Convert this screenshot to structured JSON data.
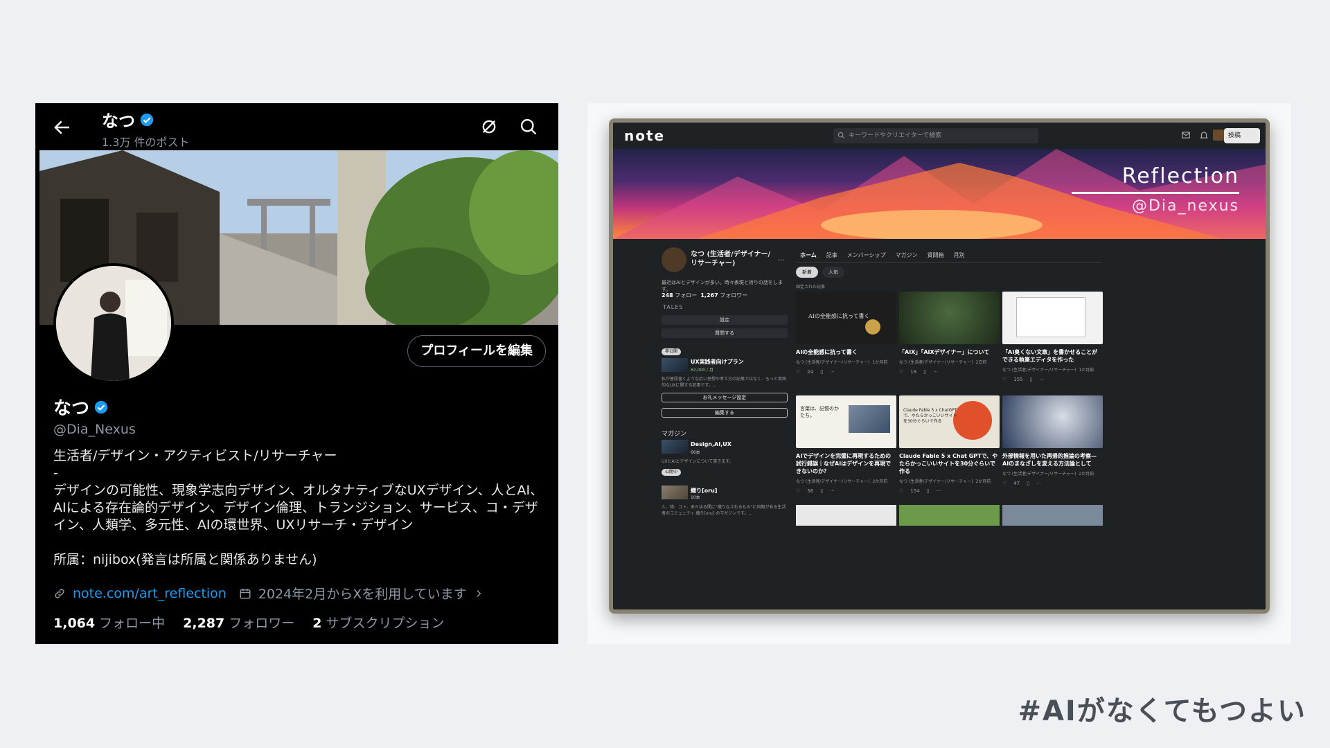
{
  "x_profile": {
    "header": {
      "title": "なつ",
      "post_count": "1.3万 件のポスト"
    },
    "edit_profile_label": "プロフィールを編集",
    "name": "なつ",
    "handle": "@Dia_Nexus",
    "bio": "生活者/デザイン・アクティビスト/リサーチャー\n-\nデザインの可能性、現象学志向デザイン、オルタナティブなUXデザイン、人とAI、AIによる存在論的デザイン、デザイン倫理、トランジション、サービス、コ・デザイン、人類学、多元性、AIの環世界、UXリサーチ・デザイン\n\n所属：nijibox(発言は所属と関係ありません)",
    "link": "note.com/art_reflection",
    "joined": "2024年2月からXを利用しています",
    "following_count": "1,064",
    "following_label": "フォロー中",
    "followers_count": "2,287",
    "followers_label": "フォロワー",
    "subs_count": "2",
    "subs_label": "サブスクリプション",
    "colors": {
      "background": "#000000",
      "accent": "#1d9bf0",
      "verified": "#1d9bf0"
    }
  },
  "note_page": {
    "logo": "note",
    "search_placeholder": "キーワードやクリエイターで検索",
    "post_button": "投稿",
    "banner_title": "Reflection",
    "banner_handle": "@Dia_nexus",
    "profile": {
      "name": "なつ (生活者/デザイナー/リサーチャー)",
      "description": "最近はAIとデザインが多い。時々表現と祈りの話をします。",
      "follow_count": "248",
      "follow_label": "フォロー",
      "follower_count": "1,267",
      "follower_label": "フォロワー",
      "tales_label": "TALES",
      "settings_button": "設定",
      "question_button": "質問する"
    },
    "plan": {
      "badge": "非公開",
      "title": "UX実践者向けプラン",
      "price": "¥2,000 / 月",
      "description": "私が普段書くような広い思想や考え方の記事ではなく、もっと実践的なUXに関する記事です。...",
      "message_button": "お礼メッセージ設定",
      "edit_button": "編集する"
    },
    "magazine": {
      "section_label": "マガジン",
      "item1_title": "Design,AI,UX",
      "item1_count": "66本",
      "item1_desc": "UXとAIとデザインについて書きます。",
      "badge": "公開中",
      "item2_title": "織り[oru]",
      "item2_count": "10本",
      "item2_desc": "人、物、コト、あらゆる間に\"織りなされるもの\"に同期がある生活者のコミュニティ 織り[oru] のマガジンです。..."
    },
    "tabs": [
      "ホーム",
      "記事",
      "メンバーシップ",
      "マガジン",
      "質問箱",
      "月別"
    ],
    "chips": [
      "新着",
      "人気"
    ],
    "pinned_label": "固定された記事",
    "articles": [
      {
        "title": "AIの全能感に抗って書く",
        "author": "なつ (生活者/デザイナー/リサーチャー)",
        "ago": "1か月前",
        "likes": "24",
        "img_text": "AIの全能感に抗って書く"
      },
      {
        "title": "「AIX」「AIXデザイナー」について",
        "author": "なつ (生活者/デザイナー/リサーチャー)",
        "ago": "2日前",
        "likes": "18"
      },
      {
        "title": "「AI臭くない文章」を書かせることができる執筆エディタを作った",
        "author": "なつ (生活者/デザイナー/リサーチャー)",
        "ago": "1か月前",
        "likes": "155"
      },
      {
        "title": "AIでデザインを完璧に再現するための試行錯誤｜なぜAIはデザインを再現できないのか？",
        "author": "なつ (生活者/デザイナー/リサーチャー)",
        "ago": "2か月前",
        "likes": "56",
        "img_text": "言葉は、記憶のかたち。"
      },
      {
        "title": "Claude Fable 5 x Chat GPTで、やたらかっこいいサイトを30分ぐらいで作る",
        "author": "なつ (生活者/デザイナー/リサーチャー)",
        "ago": "2か月前",
        "likes": "154",
        "img_text": "Claude Fable 5 x ChatGPT で、やたらかっこいいサイトを30分ぐらいで作る"
      },
      {
        "title": "外部情報を用いた再帰的推論の考察—AIのまなざしを変える方法論として",
        "author": "なつ (生活者/デザイナー/リサーチャー)",
        "ago": "2か月前",
        "likes": "47"
      }
    ]
  },
  "hashtag": "#AIがなくてもつよい"
}
